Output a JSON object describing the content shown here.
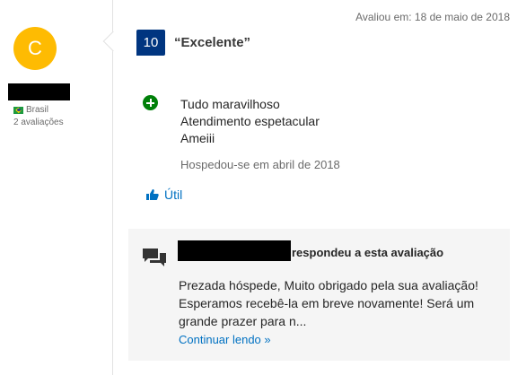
{
  "reviewer": {
    "avatar_letter": "C",
    "country": "Brasil",
    "reviews_count": "2 avaliações"
  },
  "review": {
    "date": "Avaliou em: 18 de maio de 2018",
    "score": "10",
    "title": "“Excelente”",
    "positive_lines": [
      "Tudo maravilhoso",
      "Atendimento espetacular",
      "Ameiii"
    ],
    "stayed": "Hospedou-se em abril de 2018",
    "useful_label": "Útil"
  },
  "reply": {
    "header": "respondeu a esta avaliação",
    "text": "Prezada hóspede, Muito obrigado pela sua avaliação! Esperamos recebê-la em breve novamente! Será um grande prazer para n...",
    "read_more": "Continuar lendo »"
  },
  "colors": {
    "brand_blue": "#003580",
    "link_blue": "#0071c2",
    "avatar_yellow": "#febb02",
    "positive_green": "#008009"
  }
}
